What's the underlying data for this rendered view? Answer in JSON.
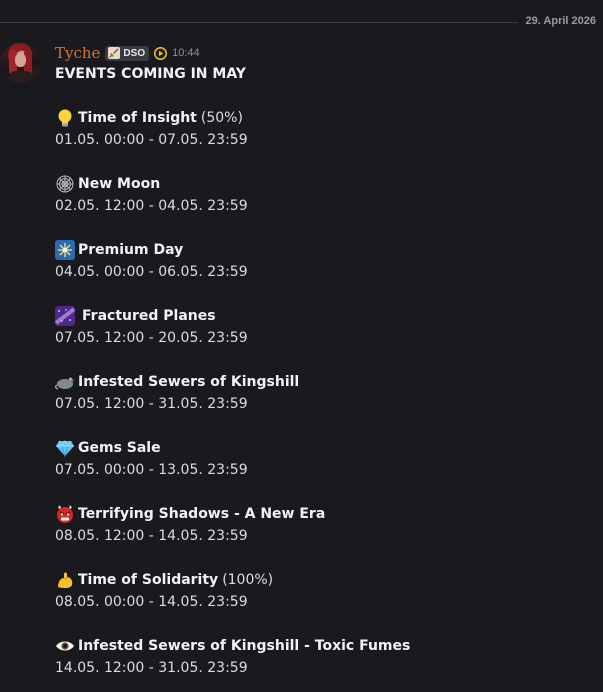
{
  "date_divider": "29. April 2026",
  "message": {
    "username": "Tyche",
    "tag": {
      "icon": "sword-icon",
      "label": "DSO"
    },
    "badge_icon": "play-badge-icon",
    "timestamp": "10:44",
    "title": "EVENTS COMING IN MAY",
    "events": [
      {
        "icon": "lightbulb-emoji",
        "name": "Time of Insight",
        "extra": "(50%)",
        "dates": "01.05. 00:00 - 07.05. 23:59"
      },
      {
        "icon": "spiderweb-emoji",
        "name": "New Moon",
        "extra": "",
        "dates": "02.05. 12:00 - 04.05. 23:59"
      },
      {
        "icon": "sparkler-emoji",
        "name": "Premium Day",
        "extra": "",
        "dates": "04.05. 00:00 - 06.05. 23:59"
      },
      {
        "icon": "milky-way-emoji",
        "name": "Fractured Planes",
        "extra": "",
        "dates": "07.05. 12:00 - 20.05. 23:59"
      },
      {
        "icon": "rat-emoji",
        "name": "Infested Sewers of Kingshill",
        "extra": "",
        "dates": "07.05. 12:00 - 31.05. 23:59"
      },
      {
        "icon": "gem-emoji",
        "name": "Gems Sale",
        "extra": "",
        "dates": "07.05. 00:00 - 13.05. 23:59"
      },
      {
        "icon": "ogre-emoji",
        "name": "Terrifying Shadows - A New Era",
        "extra": "",
        "dates": "08.05. 12:00 - 14.05. 23:59"
      },
      {
        "icon": "flexed-biceps-emoji",
        "name": "Time of Solidarity",
        "extra": "(100%)",
        "dates": "08.05. 00:00 - 14.05. 23:59"
      },
      {
        "icon": "eye-emoji",
        "name": "Infested Sewers of Kingshill - Toxic Fumes",
        "extra": "",
        "dates": "14.05. 12:00 - 31.05. 23:59"
      }
    ]
  },
  "colors": {
    "background": "#1a1a1e",
    "username": "#d2772f",
    "text": "#dbdee1",
    "heading": "#f2f3f5",
    "muted": "#8e9099"
  }
}
